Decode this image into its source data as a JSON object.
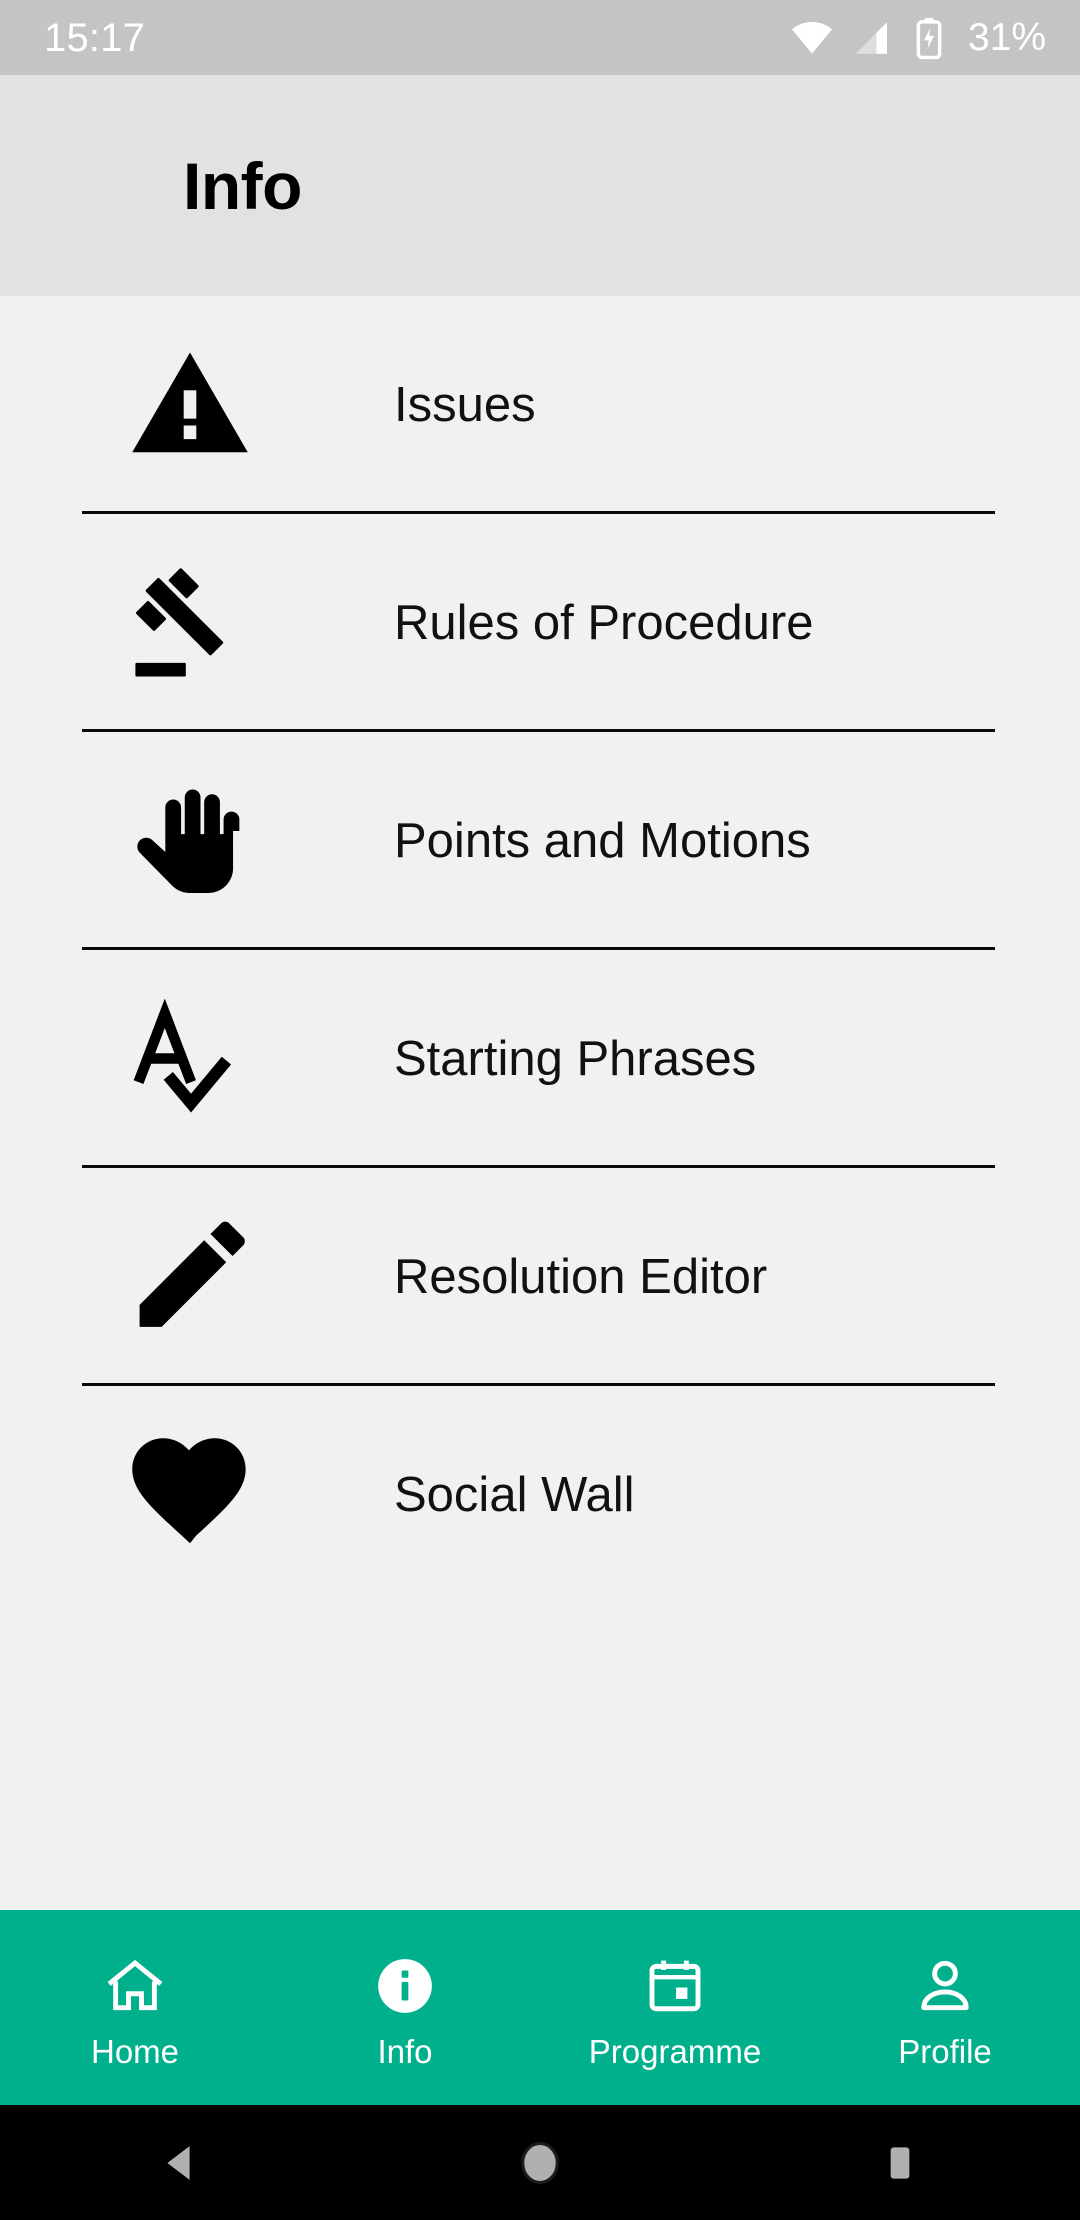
{
  "status_bar": {
    "time": "15:17",
    "battery_text": "31%",
    "icons": [
      "wifi-icon",
      "cellular-signal-icon",
      "battery-charging-icon"
    ]
  },
  "header": {
    "title": "Info"
  },
  "list": {
    "items": [
      {
        "label": "Issues",
        "icon": "warning-triangle-icon"
      },
      {
        "label": "Rules of Procedure",
        "icon": "gavel-icon"
      },
      {
        "label": "Points and Motions",
        "icon": "raised-hand-icon"
      },
      {
        "label": "Starting Phrases",
        "icon": "spellcheck-icon"
      },
      {
        "label": "Resolution Editor",
        "icon": "pencil-icon"
      },
      {
        "label": "Social Wall",
        "icon": "heart-icon"
      }
    ]
  },
  "tab_bar": {
    "tabs": [
      {
        "label": "Home",
        "icon": "home-icon",
        "active": false
      },
      {
        "label": "Info",
        "icon": "info-icon",
        "active": true
      },
      {
        "label": "Programme",
        "icon": "calendar-icon",
        "active": false
      },
      {
        "label": "Profile",
        "icon": "person-icon",
        "active": false
      }
    ]
  },
  "android_nav": {
    "buttons": [
      {
        "name": "back-button",
        "icon": "triangle-back-icon"
      },
      {
        "name": "home-button",
        "icon": "circle-home-icon"
      },
      {
        "name": "recents-button",
        "icon": "square-recents-icon"
      }
    ]
  },
  "colors": {
    "accent": "#00b08d",
    "status_bar_bg": "#c4c4c4",
    "header_bg": "#e2e2e2",
    "content_bg": "#f1f1f1",
    "divider": "#0a0a0a",
    "nav_bg": "#000000"
  }
}
